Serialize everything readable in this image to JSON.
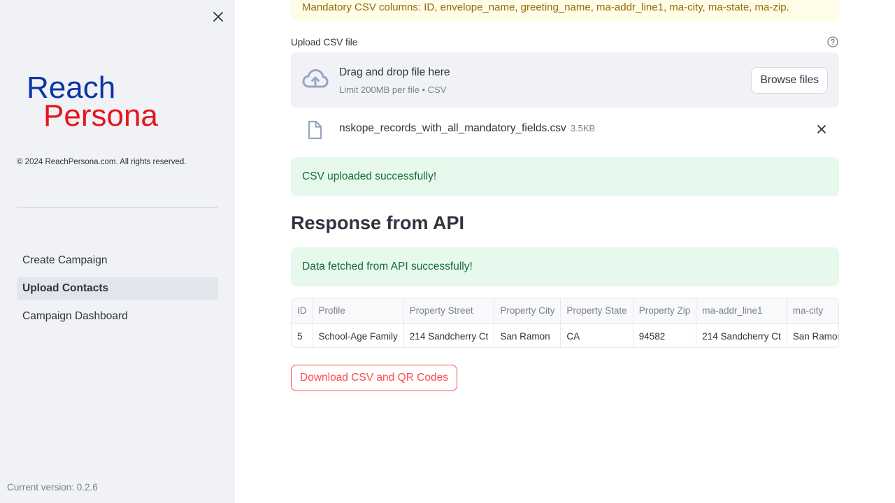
{
  "sidebar": {
    "logo_line1": "Reach",
    "logo_line2": "Persona",
    "copyright": "© 2024 ReachPersona.com. All rights reserved.",
    "nav": [
      {
        "label": "Create Campaign",
        "active": false
      },
      {
        "label": "Upload Contacts",
        "active": true
      },
      {
        "label": "Campaign Dashboard",
        "active": false
      }
    ],
    "version": "Current version: 0.2.6"
  },
  "main": {
    "warning": "Mandatory CSV columns: ID, envelope_name, greeting_name, ma-addr_line1, ma-city, ma-state, ma-zip.",
    "upload_label": "Upload CSV file",
    "dropzone_title": "Drag and drop file here",
    "dropzone_sub": "Limit 200MB per file • CSV",
    "browse_label": "Browse files",
    "file_name": "nskope_records_with_all_mandatory_fields.csv",
    "file_size": "3.5KB",
    "upload_success": "CSV uploaded successfully!",
    "section_title": "Response from API",
    "api_success": "Data fetched from API successfully!",
    "table": {
      "columns": [
        "ID",
        "Profile",
        "Property Street",
        "Property City",
        "Property State",
        "Property Zip",
        "ma-addr_line1",
        "ma-city"
      ],
      "rows": [
        [
          "5",
          "School-Age Family",
          "214 Sandcherry Ct",
          "San Ramon",
          "CA",
          "94582",
          "214 Sandcherry Ct",
          "San Ramon"
        ]
      ]
    },
    "download_label": "Download CSV and QR Codes"
  },
  "colors": {
    "sidebar_bg": "#f0f2f6",
    "accent_red": "#ff4b4b",
    "success_bg": "#e7f8ec",
    "success_text": "#176c36",
    "warning_bg": "#fffce7",
    "warning_text": "#926c05",
    "logo_blue": "#0b35a8",
    "logo_red": "#e8141c"
  }
}
